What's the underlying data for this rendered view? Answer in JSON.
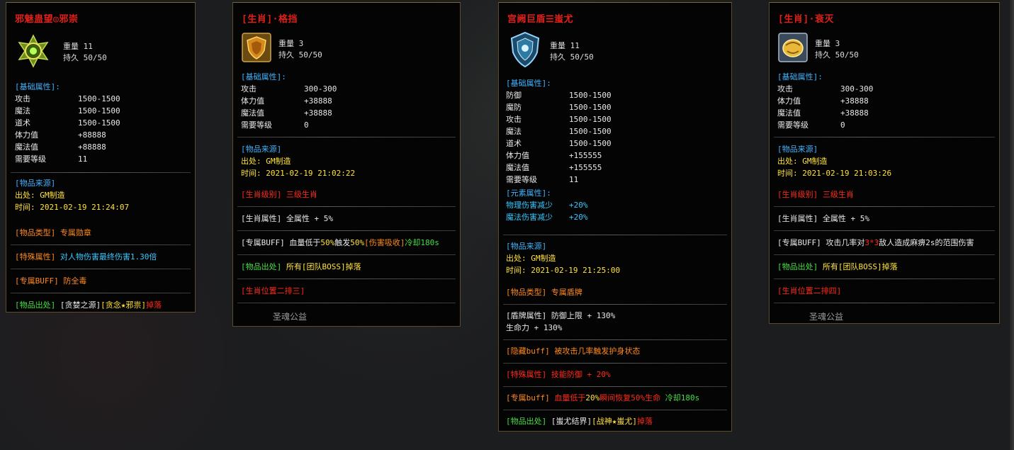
{
  "panels": [
    {
      "title": "邪魅蛊望◎邪崇",
      "weight": "重量 11",
      "durability": "持久 50/50",
      "base_header": "[基础属性]:",
      "base_stats": [
        {
          "k": "攻击",
          "v": "1500-1500"
        },
        {
          "k": "魔法",
          "v": "1500-1500"
        },
        {
          "k": "道术",
          "v": "1500-1500"
        },
        {
          "k": "体力值",
          "v": "+88888"
        },
        {
          "k": "魔法值",
          "v": "+88888"
        },
        {
          "k": "需要等级",
          "v": "11"
        }
      ],
      "source_header": "[物品来源]",
      "source_from": "出处: GM制造",
      "source_time": "时间: 2021-02-19 21:24:07",
      "lines": [
        [
          {
            "t": "[物品类型]",
            "c": "orange"
          },
          {
            "t": " 专属勋章",
            "c": "orange"
          }
        ],
        [
          {
            "t": "[特殊属性]",
            "c": "orange"
          },
          {
            "t": " 对人物伤害最终伤害1.30倍",
            "c": "cyan"
          }
        ],
        [
          {
            "t": "[专属BUFF]",
            "c": "orange"
          },
          {
            "t": " 防全毒",
            "c": "orange"
          }
        ],
        [
          {
            "t": "[物品出处]",
            "c": "green"
          },
          {
            "t": " [贪婪之源]",
            "c": "lbl-white"
          },
          {
            "t": "[贪念★邪祟]",
            "c": "yellow"
          },
          {
            "t": "掉落",
            "c": "red"
          }
        ]
      ]
    },
    {
      "title": "[生肖]·格挡",
      "weight": "重量 3",
      "durability": "持久 50/50",
      "base_header": "[基础属性]:",
      "base_stats": [
        {
          "k": "攻击",
          "v": "300-300"
        },
        {
          "k": "体力值",
          "v": "+38888"
        },
        {
          "k": "魔法值",
          "v": "+38888"
        },
        {
          "k": "需要等级",
          "v": "0"
        }
      ],
      "source_header": "[物品来源]",
      "source_from": "出处: GM制造",
      "source_time": "时间: 2021-02-19 21:02:22",
      "lines": [
        [
          {
            "t": "[生肖级别] 三级生肖",
            "c": "red"
          }
        ],
        [
          {
            "t": "[生肖属性] 全属性 + 5%",
            "c": "lbl-white"
          }
        ],
        [
          {
            "t": "[专属BUFF] 血量低于",
            "c": "lbl-white"
          },
          {
            "t": "50%",
            "c": "yellow"
          },
          {
            "t": "触发",
            "c": "lbl-white"
          },
          {
            "t": "50%",
            "c": "yellow"
          },
          {
            "t": "[伤害吸收]",
            "c": "orange"
          },
          {
            "t": "冷却180s",
            "c": "green"
          }
        ],
        [
          {
            "t": "[物品出处]",
            "c": "green"
          },
          {
            "t": " 所有[团队BOSS]掉落",
            "c": "yellow"
          }
        ],
        [
          {
            "t": "[生肖位置二排三]",
            "c": "red"
          }
        ]
      ],
      "footer": "圣魂公益"
    },
    {
      "title": "宫阙巨盾☰蚩尤",
      "weight": "重量 11",
      "durability": "持久 50/50",
      "base_header": "[基础属性]:",
      "base_stats": [
        {
          "k": "防御",
          "v": "1500-1500"
        },
        {
          "k": "魔防",
          "v": "1500-1500"
        },
        {
          "k": "攻击",
          "v": "1500-1500"
        },
        {
          "k": "魔法",
          "v": "1500-1500"
        },
        {
          "k": "道术",
          "v": "1500-1500"
        },
        {
          "k": "体力值",
          "v": "+155555"
        },
        {
          "k": "魔法值",
          "v": "+155555"
        },
        {
          "k": "需要等级",
          "v": "11"
        }
      ],
      "element_header": "[元素属性]:",
      "element_stats": [
        {
          "k": "物理伤害减少",
          "v": "+20%"
        },
        {
          "k": "魔法伤害减少",
          "v": "+20%"
        }
      ],
      "source_header": "[物品来源]",
      "source_from": "出处: GM制造",
      "source_time": "时间: 2021-02-19 21:25:00",
      "lines": [
        [
          {
            "t": "[物品类型] 专属盾牌",
            "c": "orange"
          }
        ],
        [
          {
            "t": "[盾牌属性] 防御上限 + 130%",
            "c": "lbl-white"
          }
        ],
        [
          {
            "t": "           生命力 + 130%",
            "c": "lbl-white"
          }
        ],
        [
          {
            "t": "[隐藏buff] 被攻击几率触发护身状态",
            "c": "orange"
          }
        ],
        [
          {
            "t": "[特殊属性] 技能防御 + 20%",
            "c": "red"
          }
        ],
        [
          {
            "t": "[专属buff]",
            "c": "orange"
          },
          {
            "t": "  血量低于",
            "c": "red"
          },
          {
            "t": "20%",
            "c": "yellow"
          },
          {
            "t": "瞬间恢复",
            "c": "red"
          },
          {
            "t": "50%",
            "c": "red"
          },
          {
            "t": "生命",
            "c": "red"
          },
          {
            "t": "  冷却180s",
            "c": "green"
          }
        ],
        [
          {
            "t": "[物品出处]",
            "c": "green"
          },
          {
            "t": " [蚩尤结界]",
            "c": "lbl-white"
          },
          {
            "t": "[战神★蚩尤]",
            "c": "yellow"
          },
          {
            "t": "掉落",
            "c": "red"
          }
        ]
      ]
    },
    {
      "title": "[生肖]·衰灭",
      "weight": "重量 3",
      "durability": "持久 50/50",
      "base_header": "[基础属性]:",
      "base_stats": [
        {
          "k": "攻击",
          "v": "300-300"
        },
        {
          "k": "体力值",
          "v": "+38888"
        },
        {
          "k": "魔法值",
          "v": "+38888"
        },
        {
          "k": "需要等级",
          "v": "0"
        }
      ],
      "source_header": "[物品来源]",
      "source_from": "出处: GM制造",
      "source_time": "时间: 2021-02-19 21:03:26",
      "lines": [
        [
          {
            "t": "[生肖级别] 三级生肖",
            "c": "red"
          }
        ],
        [
          {
            "t": "[生肖属性] 全属性 + 5%",
            "c": "lbl-white"
          }
        ],
        [
          {
            "t": "[专属BUFF] 攻击几率对",
            "c": "lbl-white"
          },
          {
            "t": "3*3",
            "c": "red"
          },
          {
            "t": "敌人造成麻痹2s的范围伤害",
            "c": "lbl-white"
          }
        ],
        [
          {
            "t": "[物品出处]",
            "c": "green"
          },
          {
            "t": " 所有[团队BOSS]掉落",
            "c": "yellow"
          }
        ],
        [
          {
            "t": "[生肖位置二排四]",
            "c": "red"
          }
        ]
      ],
      "footer": "圣魂公益"
    }
  ]
}
